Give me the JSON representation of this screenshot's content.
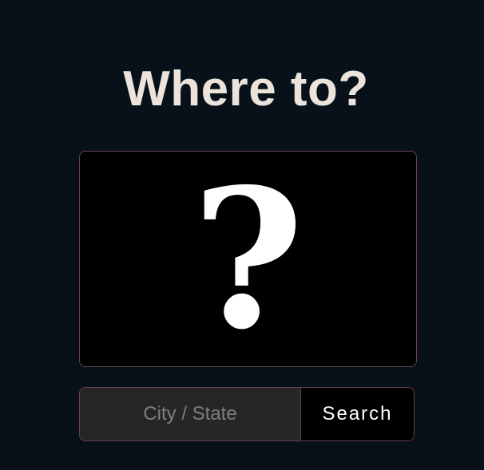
{
  "page": {
    "title": "Where to?"
  },
  "image": {
    "glyph": "?",
    "icon": "question-mark"
  },
  "search": {
    "value": "",
    "placeholder": "City / State",
    "button_label": "Search"
  },
  "colors": {
    "background": "#08111a",
    "title": "#ece3da",
    "border": "#6a4050",
    "input_bg": "#262626",
    "button_bg": "#000000"
  }
}
